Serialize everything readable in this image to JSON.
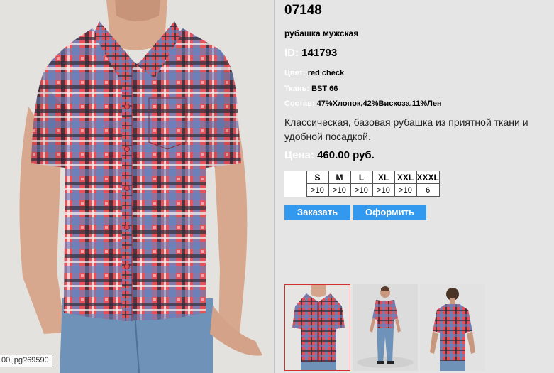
{
  "product": {
    "article": "07148",
    "name": "рубашка мужская",
    "id_label": "ID:",
    "id_value": "141793",
    "color_label": "Цвет:",
    "color_value": "red check",
    "fabric_label": "Ткань:",
    "fabric_value": "BST 66",
    "composition_label": "Состав:",
    "composition_value": "47%Хлопок,42%Вискоза,11%Лен",
    "description": "Классическая, базовая рубашка из приятной ткани и удобной посадкой.",
    "price_label": "Цена:",
    "price_value": "460.00 руб."
  },
  "sizes": {
    "headers": [
      "S",
      "M",
      "L",
      "XL",
      "XXL",
      "XXXL"
    ],
    "quantities": [
      ">10",
      ">10",
      ">10",
      ">10",
      ">10",
      "6"
    ]
  },
  "buttons": {
    "order": "Заказать",
    "checkout": "Оформить"
  },
  "status_url": "00.jpg?69590",
  "thumbnails": [
    {
      "icon": "shirt-closeup-thumbnail",
      "selected": true
    },
    {
      "icon": "full-figure-front-thumbnail",
      "selected": false
    },
    {
      "icon": "back-view-thumbnail",
      "selected": false
    }
  ],
  "colors": {
    "accent_button": "#3399ee",
    "label_white": "#ffffff",
    "selected_border": "#d23030"
  }
}
